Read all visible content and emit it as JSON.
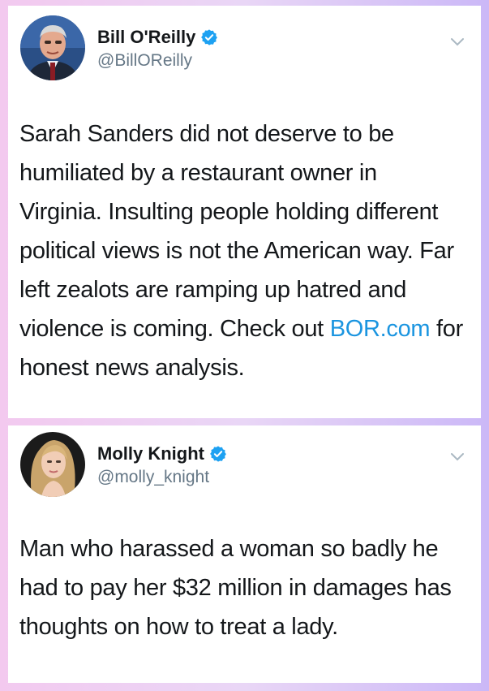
{
  "tweets": [
    {
      "display_name": "Bill O'Reilly",
      "handle": "@BillOReilly",
      "verified": true,
      "text_before_link": "Sarah Sanders did not deserve to be humiliated by a restaurant owner in Virginia. Insulting people holding different political views is not the American way. Far left zealots are ramping up hatred and violence is coming. Check out ",
      "link_text": "BOR.com",
      "text_after_link": " for honest news analysis."
    },
    {
      "display_name": "Molly Knight",
      "handle": "@molly_knight",
      "verified": true,
      "text": "Man who harassed a woman so badly he had to pay her $32 million in damages has thoughts on how to treat a lady."
    }
  ],
  "colors": {
    "verified_blue": "#1da1f2",
    "link_blue": "#1b95e0",
    "handle_gray": "#657786",
    "text_dark": "#14171a"
  },
  "icons": [
    "verified-badge-icon",
    "chevron-down-icon"
  ]
}
